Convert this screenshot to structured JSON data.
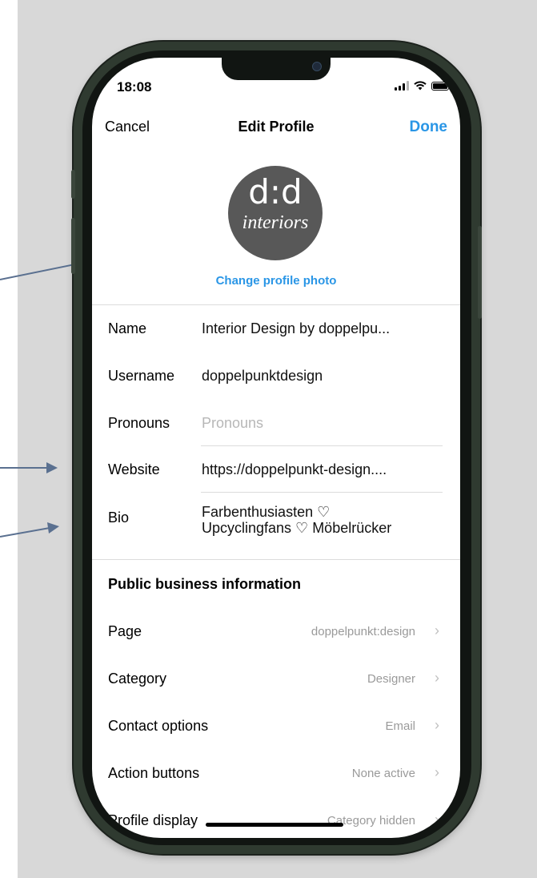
{
  "status": {
    "time": "18:08"
  },
  "nav": {
    "cancel": "Cancel",
    "title": "Edit Profile",
    "done": "Done"
  },
  "profile": {
    "avatar_mark": "d:d",
    "avatar_script": "interiors",
    "change_photo": "Change profile photo"
  },
  "fields": {
    "name": {
      "label": "Name",
      "value": "Interior Design by doppelpu..."
    },
    "username": {
      "label": "Username",
      "value": "doppelpunktdesign"
    },
    "pronouns": {
      "label": "Pronouns",
      "placeholder": "Pronouns"
    },
    "website": {
      "label": "Website",
      "value": "https://doppelpunkt-design...."
    },
    "bio": {
      "label": "Bio",
      "line1": "Farbenthusiasten ♡",
      "line2": "Upcyclingfans ♡ Möbelrücker"
    }
  },
  "business": {
    "title": "Public business information",
    "rows": [
      {
        "label": "Page",
        "value": "doppelpunkt:design"
      },
      {
        "label": "Category",
        "value": "Designer"
      },
      {
        "label": "Contact options",
        "value": "Email"
      },
      {
        "label": "Action buttons",
        "value": "None active"
      },
      {
        "label": "Profile display",
        "value": "Category hidden"
      }
    ]
  },
  "colors": {
    "accent": "#2a96e6",
    "phone_frame": "#2f3a30",
    "annotation_arrow": "#5a7090"
  },
  "icons": [
    "signal-icon",
    "wifi-icon",
    "battery-icon",
    "chevron-right-icon"
  ]
}
